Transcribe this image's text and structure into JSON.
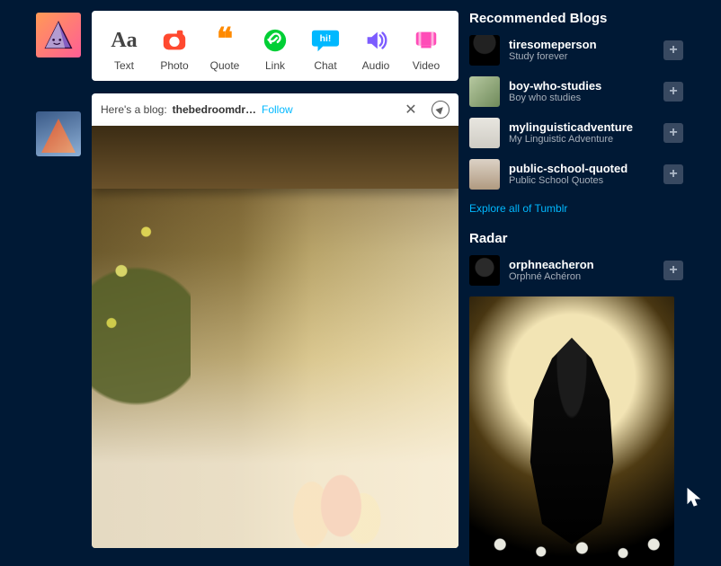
{
  "compose": {
    "text": {
      "label": "Text",
      "glyph": "Aa"
    },
    "photo": {
      "label": "Photo"
    },
    "quote": {
      "label": "Quote"
    },
    "link": {
      "label": "Link"
    },
    "chat": {
      "label": "Chat",
      "glyph": "hi!"
    },
    "audio": {
      "label": "Audio"
    },
    "video": {
      "label": "Video"
    }
  },
  "post": {
    "intro": "Here's a blog:",
    "blog_name": "thebedroomdr…",
    "follow_label": "Follow"
  },
  "right": {
    "recommended_title": "Recommended Blogs",
    "blogs": [
      {
        "name": "tiresomeperson",
        "desc": "Study forever"
      },
      {
        "name": "boy-who-studies",
        "desc": "Boy who studies"
      },
      {
        "name": "mylinguisticadventure",
        "desc": "My Linguistic Adventure"
      },
      {
        "name": "public-school-quoted",
        "desc": "Public School Quotes"
      }
    ],
    "explore_label": "Explore all of Tumblr",
    "radar_title": "Radar",
    "radar_blog": {
      "name": "orphneacheron",
      "desc": "Orphné Achéron"
    },
    "follow_plus": "+"
  }
}
